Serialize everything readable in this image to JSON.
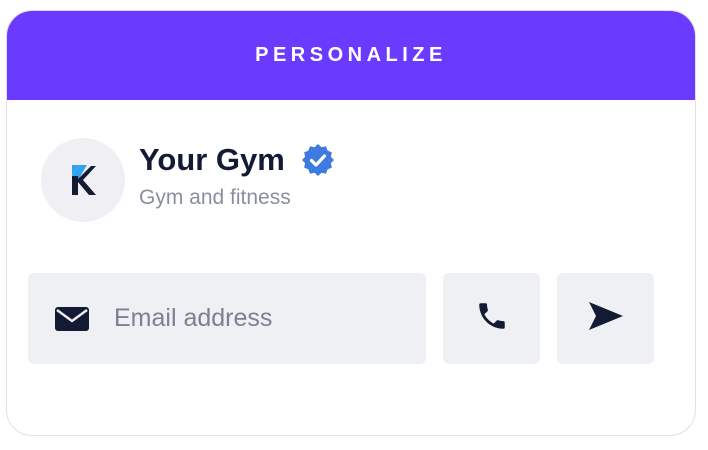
{
  "header": {
    "title": "PERSONALIZE",
    "background": "#6a3bff"
  },
  "profile": {
    "avatar_icon": "k-logo-icon",
    "name": "Your Gym",
    "verified_icon": "verified-badge-icon",
    "verified_color": "#3d7be0",
    "category": "Gym and fitness"
  },
  "contact": {
    "email_icon": "mail-icon",
    "email_placeholder": "Email address",
    "email_value": "",
    "phone_icon": "phone-icon",
    "send_icon": "send-icon"
  },
  "colors": {
    "text_dark": "#141a33",
    "text_muted": "#8a8f9f",
    "field_bg": "#eff0f4",
    "logo_blue": "#2fa3f2"
  }
}
